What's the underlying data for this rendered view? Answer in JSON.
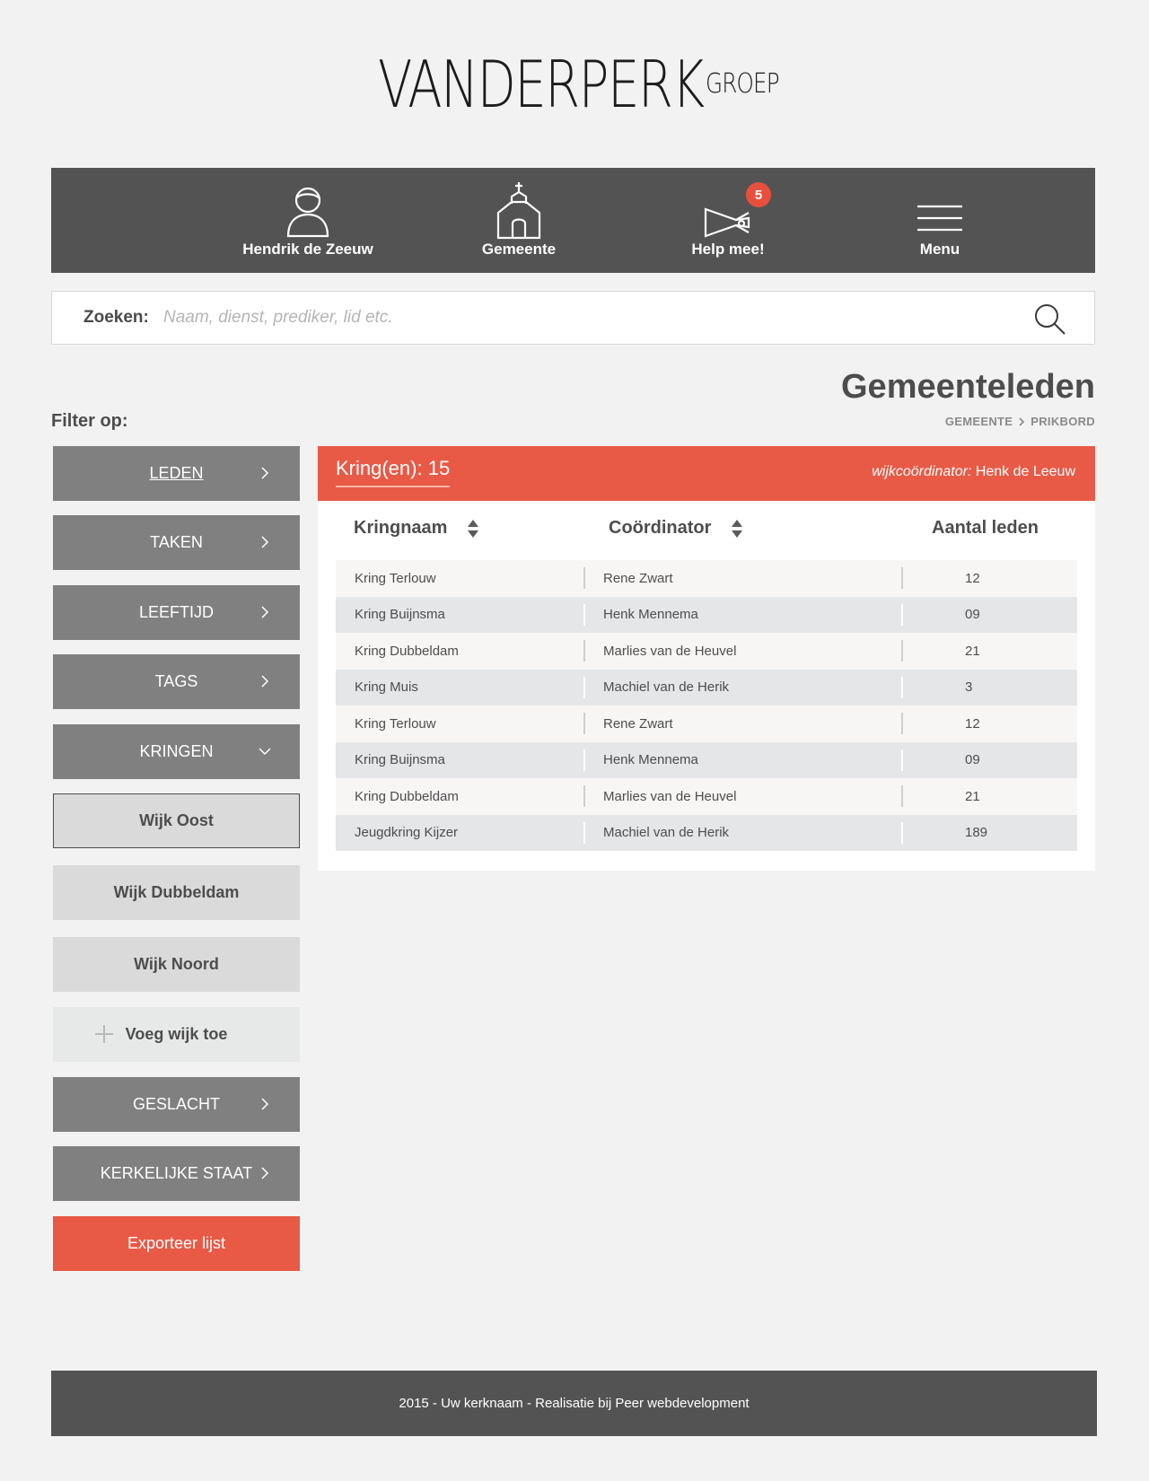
{
  "logo": {
    "main": "VANDERPERK",
    "suffix": "GROEP"
  },
  "nav": {
    "items": [
      {
        "label": "Hendrik de Zeeuw",
        "icon": "user-icon"
      },
      {
        "label": "Gemeente",
        "icon": "church-icon"
      },
      {
        "label": "Help mee!",
        "icon": "megaphone-icon",
        "badge": "5"
      },
      {
        "label": "Menu",
        "icon": "hamburger-icon"
      }
    ]
  },
  "search": {
    "label": "Zoeken:",
    "placeholder": "Naam, dienst, prediker, lid etc.",
    "value": ""
  },
  "page": {
    "title": "Gemeenteleden",
    "breadcrumb": [
      "GEMEENTE",
      "PRIKBORD"
    ]
  },
  "filter": {
    "title": "Filter op:",
    "buttons": {
      "leden": "LEDEN",
      "taken": "TAKEN",
      "leeftijd": "LEEFTIJD",
      "tags": "TAGS",
      "kringen": "KRINGEN",
      "geslacht": "GESLACHT",
      "kerkelijke_staat": "KERKELIJKE STAAT"
    },
    "wijken": [
      "Wijk Oost",
      "Wijk Dubbeldam",
      "Wijk Noord"
    ],
    "add_wijk": "Voeg wijk toe",
    "export": "Exporteer lijst"
  },
  "panel": {
    "count_label": "Kring(en): 15",
    "coordinator_prefix": "wijkcoördinator:",
    "coordinator_name": "Henk de Leeuw",
    "columns": [
      "Kringnaam",
      "Coördinator",
      "Aantal leden"
    ],
    "rows": [
      [
        "Kring Terlouw",
        "Rene Zwart",
        "12"
      ],
      [
        "Kring Buijnsma",
        "Henk Mennema",
        "09"
      ],
      [
        "Kring Dubbeldam",
        "Marlies van de Heuvel",
        "21"
      ],
      [
        "Kring Muis",
        "Machiel van de Herik",
        "3"
      ],
      [
        "Kring Terlouw",
        "Rene Zwart",
        "12"
      ],
      [
        "Kring Buijnsma",
        "Henk Mennema",
        "09"
      ],
      [
        "Kring Dubbeldam",
        "Marlies van de Heuvel",
        "21"
      ],
      [
        "Jeugdkring Kijzer",
        "Machiel van de Herik",
        "189"
      ]
    ]
  },
  "footer": {
    "text": "2015 - Uw kerknaam - Realisatie bij Peer webdevelopment"
  },
  "colors": {
    "accent": "#e85a46",
    "nav": "#535353",
    "button": "#808080",
    "logo_blue": "#2e6fb6"
  }
}
